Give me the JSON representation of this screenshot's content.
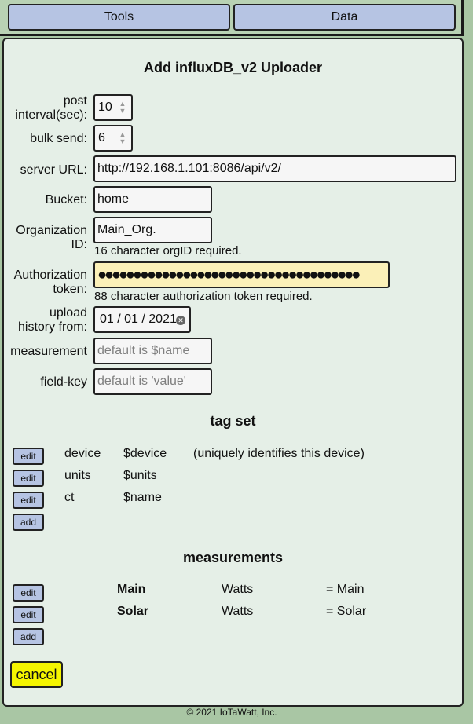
{
  "nav": {
    "tools_label": "Tools",
    "data_label": "Data"
  },
  "form": {
    "title": "Add influxDB_v2 Uploader",
    "post_interval": {
      "label_line1": "post",
      "label_line2": "interval(sec):",
      "value": "10"
    },
    "bulk_send": {
      "label": "bulk send:",
      "value": "6"
    },
    "server_url": {
      "label": "server URL:",
      "value": "http://192.168.1.101:8086/api/v2/"
    },
    "bucket": {
      "label": "Bucket:",
      "value": "home"
    },
    "org_id": {
      "label_line1": "Organization",
      "label_line2": "ID:",
      "value": "Main_Org.",
      "hint": "16 character orgID required."
    },
    "auth_token": {
      "label_line1": "Authorization",
      "label_line2": "token:",
      "value": "●●●●●●●●●●●●●●●●●●●●●●●●●●●●●●●●●●●●●",
      "hint": "88 character authorization token required."
    },
    "upload_history": {
      "label_line1": "upload",
      "label_line2": "history from:",
      "value": "01 / 01 / 2021",
      "clear_icon": "clear-circle-icon"
    },
    "measurement": {
      "label": "measurement",
      "placeholder": "default is $name"
    },
    "field_key": {
      "label": "field-key",
      "placeholder": "default is 'value'"
    }
  },
  "tag_set": {
    "title": "tag set",
    "edit_label": "edit",
    "add_label": "add",
    "rows": [
      {
        "key": "device",
        "value": "$device",
        "note": "(uniquely identifies this device)"
      },
      {
        "key": "units",
        "value": "$units",
        "note": ""
      },
      {
        "key": "ct",
        "value": "$name",
        "note": ""
      }
    ]
  },
  "measurements": {
    "title": "measurements",
    "edit_label": "edit",
    "add_label": "add",
    "rows": [
      {
        "name": "Main",
        "units": "Watts",
        "script": "= Main"
      },
      {
        "name": "Solar",
        "units": "Watts",
        "script": "= Solar"
      }
    ]
  },
  "cancel_label": "cancel",
  "footer": "© 2021 IoTaWatt, Inc.",
  "colors": {
    "page_bg": "#a9c6a4",
    "panel_bg": "#e5efe7",
    "button_bg": "#b6c4e3",
    "cancel_bg": "#f5f500",
    "token_bg": "#fbf0b8"
  }
}
